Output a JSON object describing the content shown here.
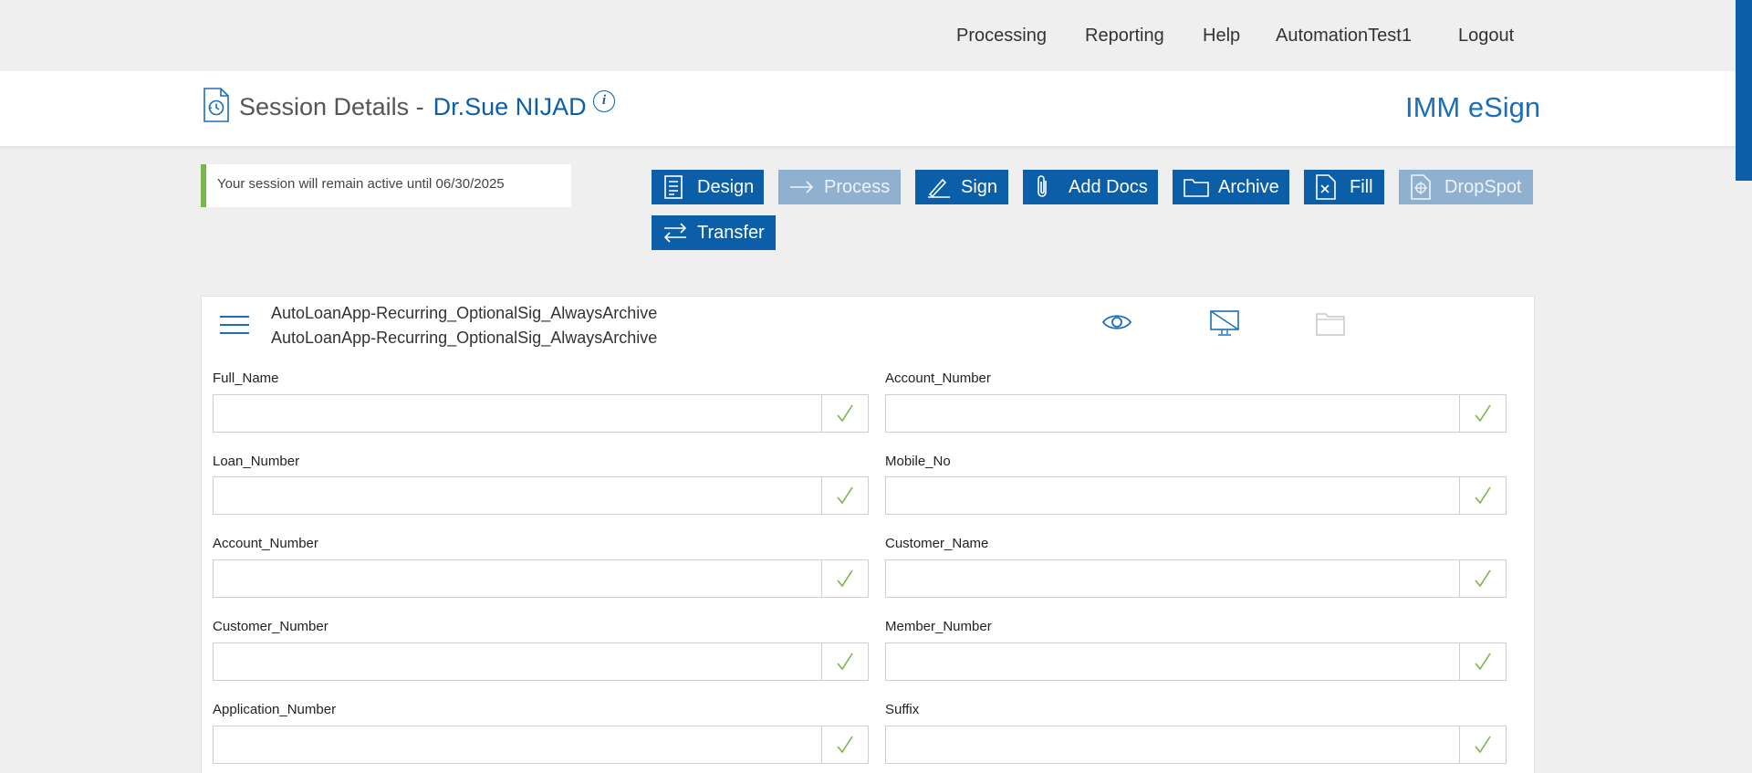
{
  "nav": {
    "items": [
      "Processing",
      "Reporting",
      "Help",
      "AutomationTest1",
      "Logout"
    ]
  },
  "header": {
    "title": "Session Details -",
    "recipient": "Dr.Sue NIJAD",
    "info": "i",
    "brand": "IMM eSign"
  },
  "notice": {
    "text": "Your session will remain active until 06/30/2025",
    "accent": "#7ab648"
  },
  "toolbar": {
    "design": "Design",
    "process": "Process",
    "sign": "Sign",
    "add_docs": "Add Docs",
    "archive": "Archive",
    "fill": "Fill",
    "dropspot": "DropSpot",
    "transfer": "Transfer"
  },
  "colors": {
    "primary": "#0a5fa8",
    "disabled": "#8fb0cf",
    "check": "#7ab648"
  },
  "document": {
    "name_1": "AutoLoanApp-Recurring_OptionalSig_AlwaysArchive",
    "name_2": "AutoLoanApp-Recurring_OptionalSig_AlwaysArchive",
    "icons": [
      "eye-icon",
      "monitor-off-icon",
      "folder-icon"
    ]
  },
  "fields": {
    "left": [
      {
        "label": "Full_Name",
        "value": ""
      },
      {
        "label": "Loan_Number",
        "value": ""
      },
      {
        "label": "Account_Number",
        "value": ""
      },
      {
        "label": "Customer_Number",
        "value": ""
      },
      {
        "label": "Application_Number",
        "value": ""
      }
    ],
    "right": [
      {
        "label": "Account_Number",
        "value": ""
      },
      {
        "label": "Mobile_No",
        "value": ""
      },
      {
        "label": "Customer_Name",
        "value": ""
      },
      {
        "label": "Member_Number",
        "value": ""
      },
      {
        "label": "Suffix",
        "value": ""
      }
    ]
  }
}
